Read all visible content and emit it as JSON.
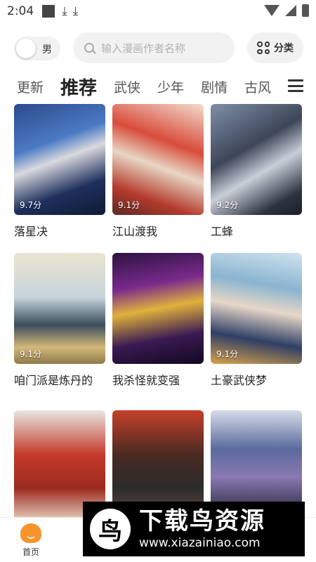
{
  "status_bar": {
    "time": "2:04"
  },
  "gender_toggle": {
    "label": "男"
  },
  "search": {
    "placeholder": "输入漫画作者名称"
  },
  "category_button": {
    "label": "分类"
  },
  "tabs": [
    {
      "label": "更新",
      "active": false
    },
    {
      "label": "推荐",
      "active": true
    },
    {
      "label": "武侠",
      "active": false
    },
    {
      "label": "少年",
      "active": false
    },
    {
      "label": "剧情",
      "active": false
    },
    {
      "label": "古风",
      "active": false
    }
  ],
  "comics": [
    {
      "title": "落星决",
      "rating": "9.7分"
    },
    {
      "title": "江山渡我",
      "rating": "9.1分"
    },
    {
      "title": "工蜂",
      "rating": "9.2分"
    },
    {
      "title": "咱门派是炼丹的",
      "rating": "9.1分"
    },
    {
      "title": "我杀怪就变强",
      "rating": ""
    },
    {
      "title": "土豪武侠梦",
      "rating": "9.1分"
    },
    {
      "title": "",
      "rating": ""
    },
    {
      "title": "",
      "rating": ""
    },
    {
      "title": "",
      "rating": ""
    }
  ],
  "bottom_nav": {
    "home_label": "首页"
  },
  "watermark": {
    "logo_char": "鸟",
    "title": "下载鸟资源",
    "url": "www.xiazainiao.com"
  },
  "colors": {
    "accent": "#f7942c"
  }
}
